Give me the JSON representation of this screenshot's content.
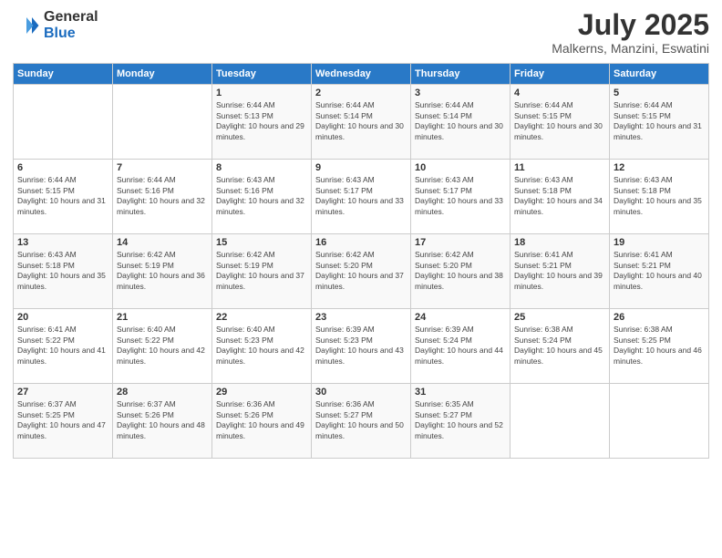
{
  "logo": {
    "general": "General",
    "blue": "Blue"
  },
  "header": {
    "month": "July 2025",
    "location": "Malkerns, Manzini, Eswatini"
  },
  "weekdays": [
    "Sunday",
    "Monday",
    "Tuesday",
    "Wednesday",
    "Thursday",
    "Friday",
    "Saturday"
  ],
  "weeks": [
    [
      null,
      null,
      {
        "day": 1,
        "sunrise": "6:44 AM",
        "sunset": "5:13 PM",
        "daylight": "10 hours and 29 minutes."
      },
      {
        "day": 2,
        "sunrise": "6:44 AM",
        "sunset": "5:14 PM",
        "daylight": "10 hours and 30 minutes."
      },
      {
        "day": 3,
        "sunrise": "6:44 AM",
        "sunset": "5:14 PM",
        "daylight": "10 hours and 30 minutes."
      },
      {
        "day": 4,
        "sunrise": "6:44 AM",
        "sunset": "5:15 PM",
        "daylight": "10 hours and 30 minutes."
      },
      {
        "day": 5,
        "sunrise": "6:44 AM",
        "sunset": "5:15 PM",
        "daylight": "10 hours and 31 minutes."
      }
    ],
    [
      {
        "day": 6,
        "sunrise": "6:44 AM",
        "sunset": "5:15 PM",
        "daylight": "10 hours and 31 minutes."
      },
      {
        "day": 7,
        "sunrise": "6:44 AM",
        "sunset": "5:16 PM",
        "daylight": "10 hours and 32 minutes."
      },
      {
        "day": 8,
        "sunrise": "6:43 AM",
        "sunset": "5:16 PM",
        "daylight": "10 hours and 32 minutes."
      },
      {
        "day": 9,
        "sunrise": "6:43 AM",
        "sunset": "5:17 PM",
        "daylight": "10 hours and 33 minutes."
      },
      {
        "day": 10,
        "sunrise": "6:43 AM",
        "sunset": "5:17 PM",
        "daylight": "10 hours and 33 minutes."
      },
      {
        "day": 11,
        "sunrise": "6:43 AM",
        "sunset": "5:18 PM",
        "daylight": "10 hours and 34 minutes."
      },
      {
        "day": 12,
        "sunrise": "6:43 AM",
        "sunset": "5:18 PM",
        "daylight": "10 hours and 35 minutes."
      }
    ],
    [
      {
        "day": 13,
        "sunrise": "6:43 AM",
        "sunset": "5:18 PM",
        "daylight": "10 hours and 35 minutes."
      },
      {
        "day": 14,
        "sunrise": "6:42 AM",
        "sunset": "5:19 PM",
        "daylight": "10 hours and 36 minutes."
      },
      {
        "day": 15,
        "sunrise": "6:42 AM",
        "sunset": "5:19 PM",
        "daylight": "10 hours and 37 minutes."
      },
      {
        "day": 16,
        "sunrise": "6:42 AM",
        "sunset": "5:20 PM",
        "daylight": "10 hours and 37 minutes."
      },
      {
        "day": 17,
        "sunrise": "6:42 AM",
        "sunset": "5:20 PM",
        "daylight": "10 hours and 38 minutes."
      },
      {
        "day": 18,
        "sunrise": "6:41 AM",
        "sunset": "5:21 PM",
        "daylight": "10 hours and 39 minutes."
      },
      {
        "day": 19,
        "sunrise": "6:41 AM",
        "sunset": "5:21 PM",
        "daylight": "10 hours and 40 minutes."
      }
    ],
    [
      {
        "day": 20,
        "sunrise": "6:41 AM",
        "sunset": "5:22 PM",
        "daylight": "10 hours and 41 minutes."
      },
      {
        "day": 21,
        "sunrise": "6:40 AM",
        "sunset": "5:22 PM",
        "daylight": "10 hours and 42 minutes."
      },
      {
        "day": 22,
        "sunrise": "6:40 AM",
        "sunset": "5:23 PM",
        "daylight": "10 hours and 42 minutes."
      },
      {
        "day": 23,
        "sunrise": "6:39 AM",
        "sunset": "5:23 PM",
        "daylight": "10 hours and 43 minutes."
      },
      {
        "day": 24,
        "sunrise": "6:39 AM",
        "sunset": "5:24 PM",
        "daylight": "10 hours and 44 minutes."
      },
      {
        "day": 25,
        "sunrise": "6:38 AM",
        "sunset": "5:24 PM",
        "daylight": "10 hours and 45 minutes."
      },
      {
        "day": 26,
        "sunrise": "6:38 AM",
        "sunset": "5:25 PM",
        "daylight": "10 hours and 46 minutes."
      }
    ],
    [
      {
        "day": 27,
        "sunrise": "6:37 AM",
        "sunset": "5:25 PM",
        "daylight": "10 hours and 47 minutes."
      },
      {
        "day": 28,
        "sunrise": "6:37 AM",
        "sunset": "5:26 PM",
        "daylight": "10 hours and 48 minutes."
      },
      {
        "day": 29,
        "sunrise": "6:36 AM",
        "sunset": "5:26 PM",
        "daylight": "10 hours and 49 minutes."
      },
      {
        "day": 30,
        "sunrise": "6:36 AM",
        "sunset": "5:27 PM",
        "daylight": "10 hours and 50 minutes."
      },
      {
        "day": 31,
        "sunrise": "6:35 AM",
        "sunset": "5:27 PM",
        "daylight": "10 hours and 52 minutes."
      },
      null,
      null
    ]
  ]
}
